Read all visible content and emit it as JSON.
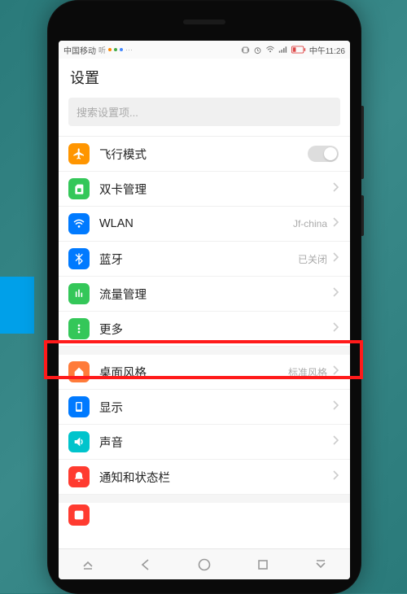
{
  "statusbar": {
    "carrier": "中国移动",
    "time": "中午11:26"
  },
  "header": {
    "title": "设置"
  },
  "search": {
    "placeholder": "搜索设置项..."
  },
  "rows": {
    "airplane": {
      "label": "飞行模式"
    },
    "dualsim": {
      "label": "双卡管理"
    },
    "wlan": {
      "label": "WLAN",
      "value": "Jf-china"
    },
    "bluetooth": {
      "label": "蓝牙",
      "value": "已关闭"
    },
    "data": {
      "label": "流量管理"
    },
    "more": {
      "label": "更多"
    },
    "homestyle": {
      "label": "桌面风格",
      "value": "标准风格"
    },
    "display": {
      "label": "显示"
    },
    "sound": {
      "label": "声音"
    },
    "notif": {
      "label": "通知和状态栏"
    }
  },
  "colors": {
    "airplane": "#ff9500",
    "dualsim": "#34c759",
    "wlan": "#007aff",
    "bluetooth": "#007aff",
    "data": "#34c759",
    "more": "#34c759",
    "homestyle": "#ff7b3a",
    "display": "#007aff",
    "sound": "#00c4cc",
    "notif": "#ff3b30",
    "partial": "#ff3b30"
  }
}
